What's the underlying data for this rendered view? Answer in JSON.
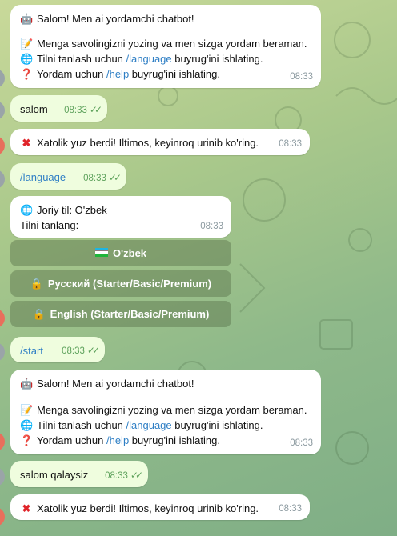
{
  "messages": {
    "m1": {
      "greeting": "Salom! Men ai yordamchi chatbot!",
      "line2": "Menga savolingizni yozing va men sizga yordam beraman.",
      "line3_pre": "Tilni tanlash uchun ",
      "line3_cmd": "/language",
      "line3_post": " buyrug'ini ishlating.",
      "line4_pre": "Yordam uchun ",
      "line4_cmd": "/help",
      "line4_post": " buyrug'ini ishlating.",
      "time": "08:33"
    },
    "m2": {
      "text": "salom",
      "time": "08:33"
    },
    "m3": {
      "text": "Xatolik yuz berdi! Iltimos, keyinroq urinib ko'ring.",
      "time": "08:33"
    },
    "m4": {
      "text": "/language",
      "time": "08:33"
    },
    "m5": {
      "line1": "Joriy til: O'zbek",
      "line2": "Tilni tanlang:",
      "time": "08:33"
    },
    "m6": {
      "text": "/start",
      "time": "08:33"
    },
    "m7": {
      "greeting": "Salom! Men ai yordamchi chatbot!",
      "line2": "Menga savolingizni yozing va men sizga yordam beraman.",
      "line3_pre": "Tilni tanlash uchun ",
      "line3_cmd": "/language",
      "line3_post": " buyrug'ini ishlating.",
      "line4_pre": "Yordam uchun ",
      "line4_cmd": "/help",
      "line4_post": " buyrug'ini ishlating.",
      "time": "08:33"
    },
    "m8": {
      "text": "salom qalaysiz",
      "time": "08:33"
    },
    "m9": {
      "text": "Xatolik yuz berdi! Iltimos, keyinroq urinib ko'ring.",
      "time": "08:33"
    }
  },
  "keyboard": {
    "uzbek": "O'zbek",
    "russian": "Русский (Starter/Basic/Premium)",
    "english": "English (Starter/Basic/Premium)"
  },
  "icons": {
    "robot": "robot-icon",
    "memo": "memo-icon",
    "globe": "globe-icon",
    "question": "question-icon",
    "cross": "cross-icon",
    "lock": "lock-icon",
    "flag": "uzbekistan-flag-icon",
    "ticks": "double-check-icon"
  },
  "colors": {
    "incoming_bubble": "#ffffff",
    "outgoing_bubble": "#effdde",
    "link": "#2f7fc5",
    "check": "#5ea25c"
  }
}
